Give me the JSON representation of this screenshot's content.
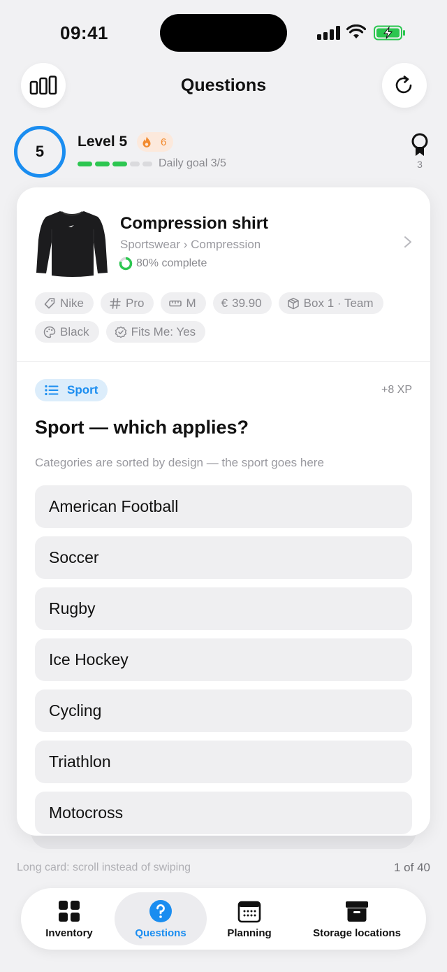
{
  "status_bar": {
    "time": "09:41"
  },
  "header": {
    "title": "Questions"
  },
  "level": {
    "value": "5",
    "title": "Level 5",
    "streak": "6",
    "daily_goal_done": 3,
    "daily_goal_total": 5,
    "daily_goal_text": "Daily goal 3/5",
    "badges": "3"
  },
  "product": {
    "name": "Compression shirt",
    "path": "Sportswear › Compression",
    "completion": 0.8,
    "completion_text": "80% complete",
    "chips": [
      {
        "icon": "tag-icon",
        "label": "Nike"
      },
      {
        "icon": "hash-icon",
        "label": "Pro"
      },
      {
        "icon": "ruler-icon",
        "label": "M"
      },
      {
        "icon": "euro-icon",
        "label": "39.90"
      },
      {
        "icon": "box-icon",
        "label": "Box 1 · Team"
      },
      {
        "icon": "palette-icon",
        "label": "Black"
      },
      {
        "icon": "check-badge-icon",
        "label": "Fits Me: Yes"
      }
    ]
  },
  "question": {
    "category": "Sport",
    "xp": "+8 XP",
    "title": "Sport — which applies?",
    "hint": "Categories are sorted by design — the sport goes here",
    "options": [
      "American Football",
      "Soccer",
      "Rugby",
      "Ice Hockey",
      "Cycling",
      "Triathlon",
      "Motocross"
    ]
  },
  "footer": {
    "hint": "Long card: scroll instead of swiping",
    "counter": "1 of 40"
  },
  "tabbar": {
    "tabs": [
      {
        "label": "Inventory",
        "icon": "grid-icon",
        "active": false
      },
      {
        "label": "Questions",
        "icon": "question-circle-icon",
        "active": true
      },
      {
        "label": "Planning",
        "icon": "calendar-icon",
        "active": false
      },
      {
        "label": "Storage locations",
        "icon": "archive-box-icon",
        "active": false
      }
    ]
  },
  "colors": {
    "accent": "#1a8df0",
    "success": "#2cc650",
    "streak": "#f28a2e"
  }
}
